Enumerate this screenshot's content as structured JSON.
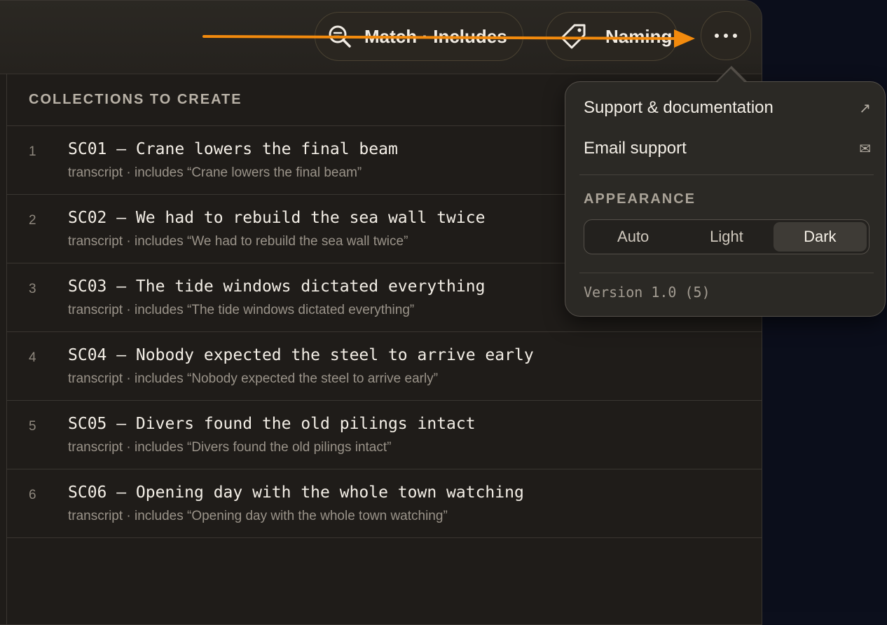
{
  "toolbar": {
    "match_label": "Match · Includes",
    "match_icon": "search-icon",
    "naming_label": "Naming",
    "naming_icon": "tag-icon",
    "more_icon": "ellipsis-icon"
  },
  "list": {
    "header": "COLLECTIONS TO CREATE",
    "rows": [
      {
        "num": "1",
        "title": "SC01 — Crane lowers the final beam",
        "sub": "transcript · includes “Crane lowers the final beam”"
      },
      {
        "num": "2",
        "title": "SC02 — We had to rebuild the sea wall twice",
        "sub": "transcript · includes “We had to rebuild the sea wall twice”"
      },
      {
        "num": "3",
        "title": "SC03 — The tide windows dictated everything",
        "sub": "transcript · includes “The tide windows dictated everything”"
      },
      {
        "num": "4",
        "title": "SC04 — Nobody expected the steel to arrive early",
        "sub": "transcript · includes “Nobody expected the steel to arrive early”"
      },
      {
        "num": "5",
        "title": "SC05 — Divers found the old pilings intact",
        "sub": "transcript · includes “Divers found the old pilings intact”"
      },
      {
        "num": "6",
        "title": "SC06 — Opening day with the whole town watching",
        "sub": "transcript · includes “Opening day with the whole town watching”"
      }
    ]
  },
  "popover": {
    "support_docs_label": "Support & documentation",
    "support_docs_icon": "external-link-icon",
    "support_docs_glyph": "↗",
    "email_support_label": "Email support",
    "email_support_icon": "envelope-icon",
    "email_support_glyph": "✉",
    "appearance_label": "APPEARANCE",
    "appearance_options": [
      "Auto",
      "Light",
      "Dark"
    ],
    "appearance_selected": "Dark",
    "version": "Version 1.0 (5)"
  },
  "colors": {
    "accent_arrow": "#f28a0d",
    "window_bg": "#1f1c19",
    "desktop_bg": "#0b0e1b",
    "popover_bg": "#2b2925"
  }
}
